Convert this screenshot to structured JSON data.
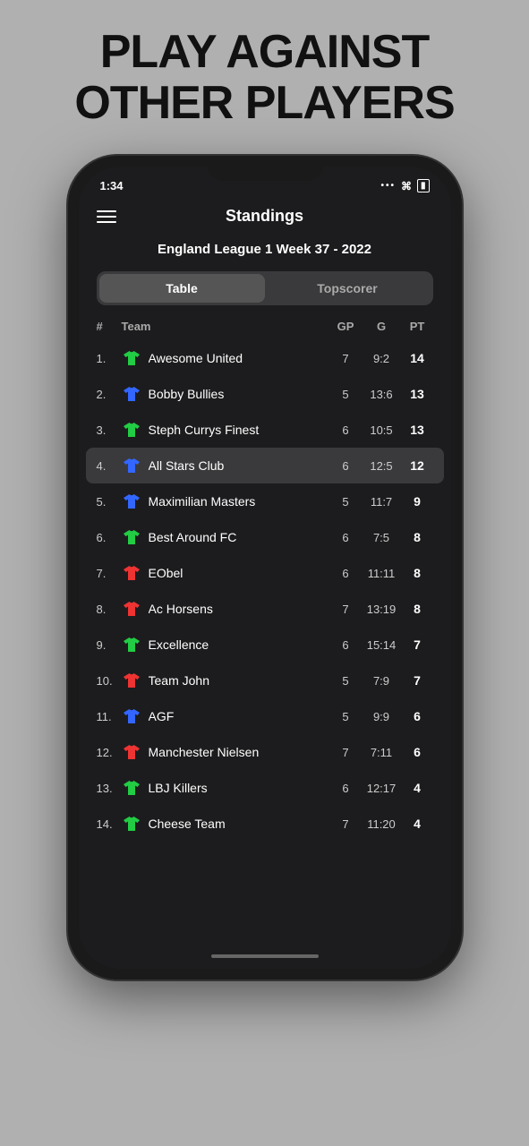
{
  "headline": {
    "line1": "PLAY AGAINST",
    "line2": "OTHER PLAYERS"
  },
  "phone": {
    "status": {
      "time": "1:34",
      "wifi": "WiFi",
      "battery": "Batt"
    },
    "app": {
      "menu_label": "Menu",
      "title": "Standings",
      "league": "England League 1 Week 37 - 2022",
      "tabs": [
        {
          "label": "Table",
          "active": true
        },
        {
          "label": "Topscorer",
          "active": false
        }
      ],
      "columns": {
        "num": "#",
        "team": "Team",
        "gp": "GP",
        "g": "G",
        "pt": "PT"
      },
      "rows": [
        {
          "rank": "1.",
          "shirt_color": "green",
          "name": "Awesome United",
          "gp": "7",
          "g": "9:2",
          "pt": "14",
          "highlighted": false
        },
        {
          "rank": "2.",
          "shirt_color": "blue",
          "name": "Bobby Bullies",
          "gp": "5",
          "g": "13:6",
          "pt": "13",
          "highlighted": false
        },
        {
          "rank": "3.",
          "shirt_color": "green",
          "name": "Steph Currys Finest",
          "gp": "6",
          "g": "10:5",
          "pt": "13",
          "highlighted": false
        },
        {
          "rank": "4.",
          "shirt_color": "blue",
          "name": "All Stars Club",
          "gp": "6",
          "g": "12:5",
          "pt": "12",
          "highlighted": true
        },
        {
          "rank": "5.",
          "shirt_color": "blue",
          "name": "Maximilian Masters",
          "gp": "5",
          "g": "11:7",
          "pt": "9",
          "highlighted": false
        },
        {
          "rank": "6.",
          "shirt_color": "green",
          "name": "Best Around FC",
          "gp": "6",
          "g": "7:5",
          "pt": "8",
          "highlighted": false
        },
        {
          "rank": "7.",
          "shirt_color": "red",
          "name": "EObel",
          "gp": "6",
          "g": "11:11",
          "pt": "8",
          "highlighted": false
        },
        {
          "rank": "8.",
          "shirt_color": "red",
          "name": "Ac Horsens",
          "gp": "7",
          "g": "13:19",
          "pt": "8",
          "highlighted": false
        },
        {
          "rank": "9.",
          "shirt_color": "green",
          "name": "Excellence",
          "gp": "6",
          "g": "15:14",
          "pt": "7",
          "highlighted": false
        },
        {
          "rank": "10.",
          "shirt_color": "red",
          "name": "Team John",
          "gp": "5",
          "g": "7:9",
          "pt": "7",
          "highlighted": false
        },
        {
          "rank": "11.",
          "shirt_color": "blue",
          "name": "AGF",
          "gp": "5",
          "g": "9:9",
          "pt": "6",
          "highlighted": false
        },
        {
          "rank": "12.",
          "shirt_color": "red",
          "name": "Manchester Nielsen",
          "gp": "7",
          "g": "7:11",
          "pt": "6",
          "highlighted": false
        },
        {
          "rank": "13.",
          "shirt_color": "green",
          "name": "LBJ Killers",
          "gp": "6",
          "g": "12:17",
          "pt": "4",
          "highlighted": false
        },
        {
          "rank": "14.",
          "shirt_color": "green",
          "name": "Cheese Team",
          "gp": "7",
          "g": "11:20",
          "pt": "4",
          "highlighted": false
        }
      ]
    }
  }
}
